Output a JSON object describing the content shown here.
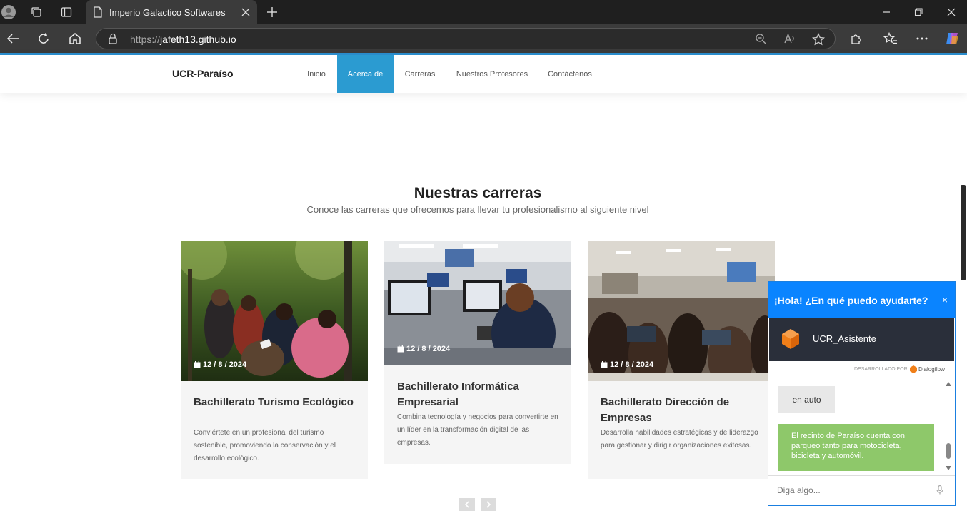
{
  "browser": {
    "tab_title": "Imperio Galactico Softwares",
    "url_protocol": "https://",
    "url_host": "jafeth13.github.io"
  },
  "navbar": {
    "brand": "UCR-Paraíso",
    "items": [
      {
        "label": "Inicio",
        "active": false
      },
      {
        "label": "Acerca de",
        "active": true
      },
      {
        "label": "Carreras",
        "active": false
      },
      {
        "label": "Nuestros Profesores",
        "active": false
      },
      {
        "label": "Contáctenos",
        "active": false
      }
    ]
  },
  "section": {
    "title": "Nuestras carreras",
    "subtitle": "Conoce las carreras que ofrecemos para llevar tu profesionalismo al siguiente nivel"
  },
  "cards": [
    {
      "date": "12 / 8 / 2024",
      "title": "Bachillerato Turismo Ecológico",
      "description": "Conviértete en un profesional del turismo sostenible, promoviendo la conservación y el desarrollo ecológico.",
      "image": "forest-students-photo"
    },
    {
      "date": "12 / 8 / 2024",
      "title": "Bachillerato Informática Empresarial",
      "description": "Combina tecnología y negocios para convertirte en un líder en la transformación digital de las empresas.",
      "image": "computer-lab-photo"
    },
    {
      "date": "12 / 8 / 2024",
      "title": "Bachillerato Dirección de Empresas",
      "description": "Desarrolla habilidades estratégicas y de liderazgo para gestionar y dirigir organizaciones exitosas.",
      "image": "classroom-laptops-photo"
    }
  ],
  "chat": {
    "header": "¡Hola! ¿En qué puedo ayudarte?",
    "close": "×",
    "agent_name": "UCR_Asistente",
    "powered_by": "DESARROLLADO POR",
    "powered_brand": "Dialogflow",
    "messages": [
      {
        "from": "user",
        "text": "en auto"
      },
      {
        "from": "bot",
        "text": "El recinto de Paraíso cuenta con parqueo tanto para motocicleta, bicicleta y automóvil."
      }
    ],
    "input_placeholder": "Diga algo..."
  },
  "colors": {
    "accent": "#2b9bd1",
    "chat_header": "#0a84ff",
    "bot_bubble": "#8ec86a"
  }
}
